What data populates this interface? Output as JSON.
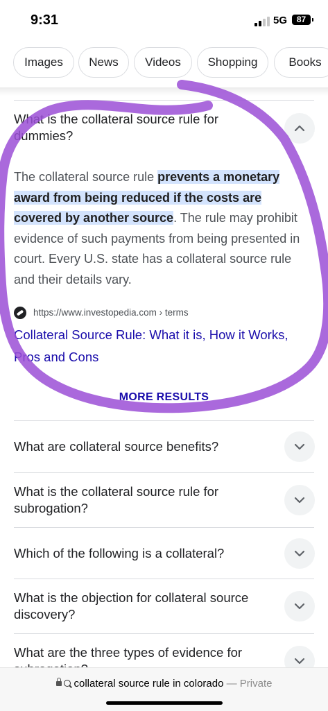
{
  "status_bar": {
    "time": "9:31",
    "network": "5G",
    "battery": "87"
  },
  "chips": [
    "Images",
    "News",
    "Videos",
    "Shopping",
    "Books"
  ],
  "expanded": {
    "question": "What is the collateral source rule for dummies?",
    "answer": {
      "lead": "The collateral source rule ",
      "highlight": "prevents a monetary award from being reduced if the costs are covered by another source",
      "rest": ". The rule may prohibit evidence of such payments from being presented in court. Every U.S. state has a collateral source rule and their details vary."
    },
    "source_url": "https://www.investopedia.com › terms",
    "link_title": "Collateral Source Rule: What it is, How it Works, Pros and Cons"
  },
  "more_results": "MORE RESULTS",
  "questions": [
    "What are collateral source benefits?",
    "What is the collateral source rule for subrogation?",
    "Which of the following is a collateral?",
    "What is the objection for collateral source discovery?",
    "What are the three types of evidence for subrogation?"
  ],
  "address_bar": {
    "query": "collateral source rule in colorado",
    "separator": "—",
    "mode": "Private"
  },
  "colors": {
    "link": "#1a0dab",
    "highlight": "#d3e3fd",
    "annotation": "#9b4fd6"
  },
  "icons": [
    "chevron-up-icon",
    "chevron-down-icon",
    "lock-icon",
    "search-icon",
    "investopedia-favicon"
  ]
}
